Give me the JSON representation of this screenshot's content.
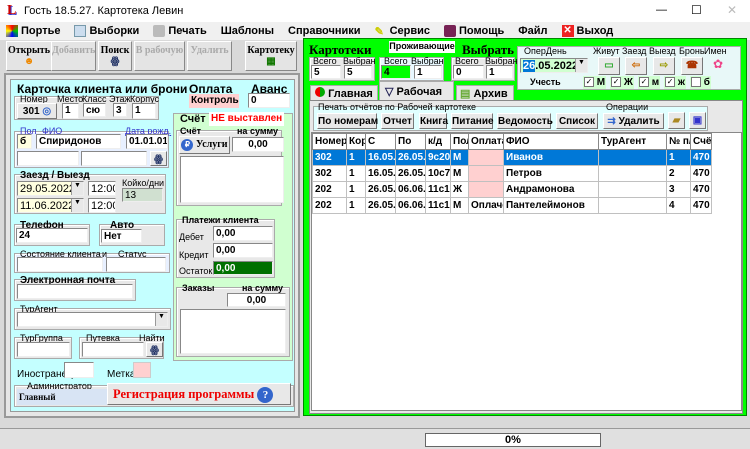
{
  "window": {
    "title": "Гость 18.5.27. Картотека Левин",
    "controls": {
      "minimize": "—",
      "maximize": "☐",
      "close": "✕"
    }
  },
  "menu": [
    {
      "label": "Портье",
      "icon": "grid-icon"
    },
    {
      "label": "Выборки",
      "icon": "table-icon"
    },
    {
      "label": "Печать",
      "icon": "printer-icon"
    },
    {
      "label": "Шаблоны"
    },
    {
      "label": "Справочники"
    },
    {
      "label": "Сервис",
      "icon": "wrench-icon"
    },
    {
      "label": "Помощь",
      "icon": "book-icon"
    },
    {
      "label": "Файл"
    },
    {
      "label": "Выход",
      "icon": "exit-icon"
    }
  ],
  "toolbar": {
    "open": "Открыть",
    "add": "Добавить",
    "search": "Поиск",
    "to_work": "В рабочую",
    "delete": "Удалить",
    "cardfile": "Картотеку"
  },
  "card": {
    "title": "Карточка клиента или брони",
    "room_label": "Номер",
    "room": "301",
    "place_label": "Место",
    "place": "1",
    "class_label": "Класс",
    "class": "сю",
    "floor_label": "Этаж",
    "floor": "3",
    "building_label": "Корпус",
    "building": "1",
    "sex_label": "Пол",
    "sex": "б",
    "fio_label": "ФИО",
    "fio": "Спиридонов",
    "dob_label": "Дата рожд.",
    "dob": "01.01.01",
    "stay_label": "Заезд / Выезд",
    "arrival": "29.05.2022",
    "arrival_time": "12:00",
    "departure": "11.06.2022",
    "departure_time": "12:00",
    "beddays_label": "Койко/дни",
    "beddays": "13",
    "phone_label": "Телефон",
    "phone": "24",
    "auto_label": "Авто",
    "auto": "Нет",
    "state_label": "Состояние клиента",
    "and_label": "и",
    "status_label": "Статус",
    "email_label": "Электронная почта",
    "agent_label": "ТурАгент",
    "group_label": "ТурГруппа",
    "voucher_label": "Путевка",
    "find_label": "Найти",
    "foreigner_label": "Иностранец",
    "mark_label": "Метка",
    "admin_label": "Администратор",
    "admin": "Главный",
    "register": "Регистрация программы"
  },
  "payment": {
    "label": "Оплата",
    "value": "Контроль",
    "advance_label": "Аванс",
    "advance": "0",
    "bill_label": "Счёт",
    "bill_status": "НЕ выставлен",
    "bill_sub": "Счёт",
    "sum_label": "на сумму",
    "services": "Услуги",
    "bill_sum": "0,00",
    "payments_label": "Платежи клиента",
    "debit_label": "Дебет",
    "debit": "0,00",
    "credit_label": "Кредит",
    "credit": "0,00",
    "balance_label": "Остаток",
    "balance": "0,00",
    "orders_label": "Заказы",
    "orders_sum_label": "на сумму",
    "orders_sum": "0,00"
  },
  "cardfiles": {
    "title": "Картотеки",
    "total_label": "Всего",
    "selected_label": "Выбран",
    "total": "5",
    "selected": "5",
    "living_title": "Проживающие",
    "living_total": "4",
    "living_selected": "1",
    "choose_title": "Выбрать",
    "choose_total": "0",
    "choose_selected": "1"
  },
  "operday": {
    "label": "ОперДень",
    "date_day": "26",
    "date_rest": ".05.2022",
    "buttons": [
      "Живут",
      "Заезд",
      "Выезд",
      "Бронь",
      "Имен"
    ],
    "consider_label": "Учесть",
    "checks": [
      {
        "label": "М",
        "checked": true
      },
      {
        "label": "Ж",
        "checked": true
      },
      {
        "label": "м",
        "checked": true
      },
      {
        "label": "ж",
        "checked": true
      },
      {
        "label": "б",
        "checked": false
      }
    ]
  },
  "tabs": [
    {
      "label": "Главная"
    },
    {
      "label": "Рабочая",
      "active": true
    },
    {
      "label": "Архив"
    }
  ],
  "reports": {
    "label": "Печать отчётов по Рабочей картотеке",
    "buttons": [
      "По номерам",
      "Отчет",
      "Книга",
      "Питание",
      "Ведомость",
      "Список"
    ],
    "ops_label": "Операции",
    "delete": "Удалить"
  },
  "table": {
    "columns": [
      "Номер",
      "Кор",
      "С",
      "По",
      "к/д",
      "Пол",
      "Оплата",
      "ФИО",
      "ТурАгент",
      "№ п/",
      "Счёт"
    ],
    "rows": [
      [
        "302",
        "1",
        "16.05.",
        "26.05.",
        "9c20",
        "М",
        "",
        "Иванов",
        "",
        "1",
        "470"
      ],
      [
        "302",
        "1",
        "16.05.",
        "26.05.",
        "10c7",
        "М",
        "",
        "Петров",
        "",
        "2",
        "470"
      ],
      [
        "202",
        "1",
        "26.05.",
        "06.06.",
        "11c1",
        "Ж",
        "",
        "Андрамонова",
        "",
        "3",
        "470"
      ],
      [
        "202",
        "1",
        "26.05.",
        "06.06.",
        "11c1",
        "М",
        "Оплаче",
        "Пантелеймонов",
        "",
        "4",
        "470"
      ]
    ]
  },
  "status": {
    "progress": "0%"
  },
  "colors": {
    "green": "#00ff00",
    "cyan": "#c4ffff",
    "selected": "#0078d7",
    "pink": "#ffd0d0"
  }
}
